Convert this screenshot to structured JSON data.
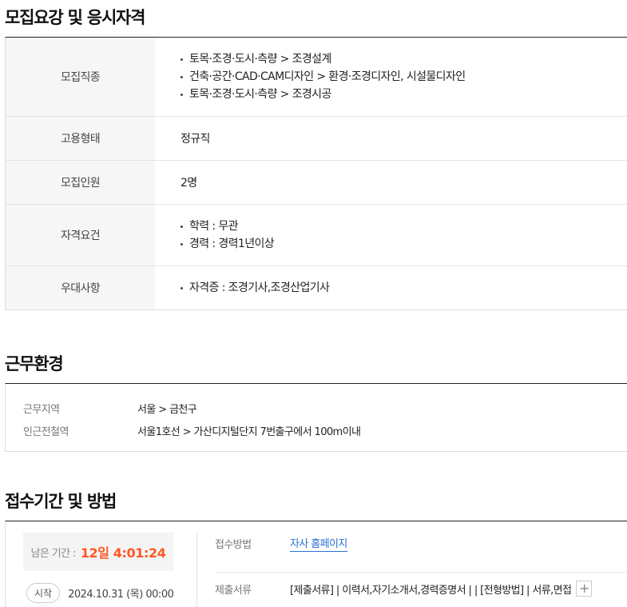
{
  "recruit": {
    "title": "모집요강 및 응시자격",
    "rows": [
      {
        "label": "모집직종",
        "items": [
          "토목·조경·도시·측량 > 조경설계",
          "건축·공간·CAD·CAM디자인 > 환경·조경디자인, 시설물디자인",
          "토목·조경·도시·측량 > 조경시공"
        ]
      },
      {
        "label": "고용형태",
        "value": "정규직"
      },
      {
        "label": "모집인원",
        "value": "2명"
      },
      {
        "label": "자격요건",
        "items": [
          "학력 : 무관",
          "경력 : 경력1년이상"
        ]
      },
      {
        "label": "우대사항",
        "items": [
          "자격증 : 조경기사,조경산업기사"
        ]
      }
    ]
  },
  "environment": {
    "title": "근무환경",
    "rows": [
      {
        "label": "근무지역",
        "value": "서울 > 금천구"
      },
      {
        "label": "인근전철역",
        "value": "서울1호선 > 가산디지털단지 7번출구에서 100m이내"
      }
    ]
  },
  "apply": {
    "title": "접수기간 및 방법",
    "remaining_label": "남은 기간 :",
    "remaining_value": "12일 4:01:24",
    "start_badge": "시작",
    "start_date": "2024.10.31 (목) 00:00",
    "method_label": "접수방법",
    "method_value": "자사 홈페이지",
    "docs_label": "제출서류",
    "docs_value": "[제출서류] | 이력서,자기소개서,경력증명서 | | [전형방법] | 서류,면접",
    "plus_symbol": "+"
  }
}
